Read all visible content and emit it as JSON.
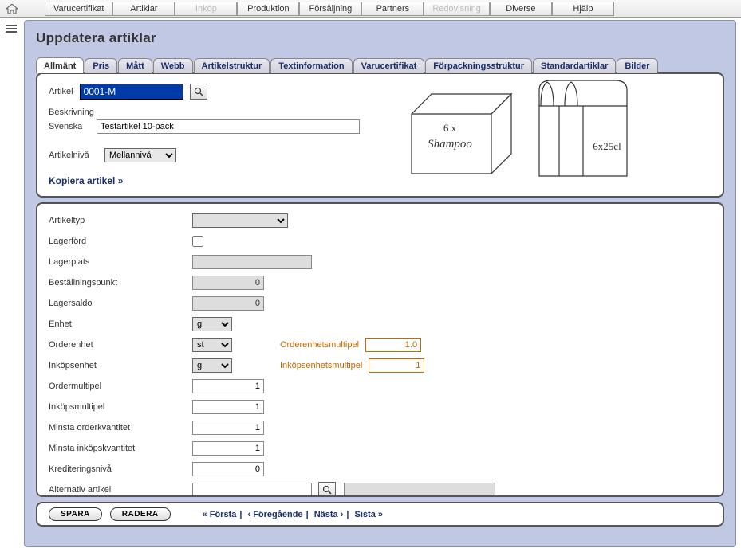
{
  "menu": [
    "Varucertifikat",
    "Artiklar",
    "Inköp",
    "Produktion",
    "Försäljning",
    "Partners",
    "Redovisning",
    "Diverse",
    "Hjälp"
  ],
  "menu_disabled": [
    2,
    6
  ],
  "title": "Uppdatera artiklar",
  "tabs": [
    "Allmänt",
    "Pris",
    "Mått",
    "Webb",
    "Artikelstruktur",
    "Textinformation",
    "Varucertifikat",
    "Förpackningsstruktur",
    "Standardartiklar",
    "Bilder"
  ],
  "active_tab": 0,
  "labels": {
    "artikel": "Artikel",
    "beskrivning": "Beskrivning",
    "svenska": "Svenska",
    "artikelniva": "Artikelnivå",
    "kopiera": "Kopiera artikel »"
  },
  "values": {
    "artikel": "0001-M",
    "svenska": "Testartikel 10-pack",
    "artikelniva": "Mellannivå"
  },
  "illus": {
    "box": "6 x",
    "box2": "Shampoo",
    "pack": "6x25cl"
  },
  "fields": [
    {
      "label": "Artikeltyp",
      "type": "select-wide",
      "value": ""
    },
    {
      "label": "Lagerförd",
      "type": "checkbox"
    },
    {
      "label": "Lagerplats",
      "type": "ro-wide",
      "value": ""
    },
    {
      "label": "Beställningspunkt",
      "type": "ro",
      "value": "0"
    },
    {
      "label": "Lagersaldo",
      "type": "ro",
      "value": "0"
    },
    {
      "label": "Enhet",
      "type": "select",
      "value": "g"
    },
    {
      "label": "Orderenhet",
      "type": "select",
      "value": "st",
      "col2label": "Orderenhetsmultipel",
      "col2value": "1.0"
    },
    {
      "label": "Inköpsenhet",
      "type": "select",
      "value": "g",
      "col2label": "Inköpsenhetsmultipel",
      "col2value": "1"
    },
    {
      "label": "Ordermultipel",
      "type": "num",
      "value": "1"
    },
    {
      "label": "Inköpsmultipel",
      "type": "num",
      "value": "1"
    },
    {
      "label": "Minsta orderkvantitet",
      "type": "num",
      "value": "1"
    },
    {
      "label": "Minsta inköpskvantitet",
      "type": "num",
      "value": "1"
    },
    {
      "label": "Krediteringsnivå",
      "type": "num",
      "value": "0"
    },
    {
      "label": "Alternativ artikel",
      "type": "alt",
      "value": ""
    }
  ],
  "buttons": {
    "save": "SPARA",
    "delete": "RADERA"
  },
  "nav": {
    "first": "« Första",
    "prev": "‹ Föregående",
    "next": "Nästa ›",
    "last": "Sista »"
  }
}
